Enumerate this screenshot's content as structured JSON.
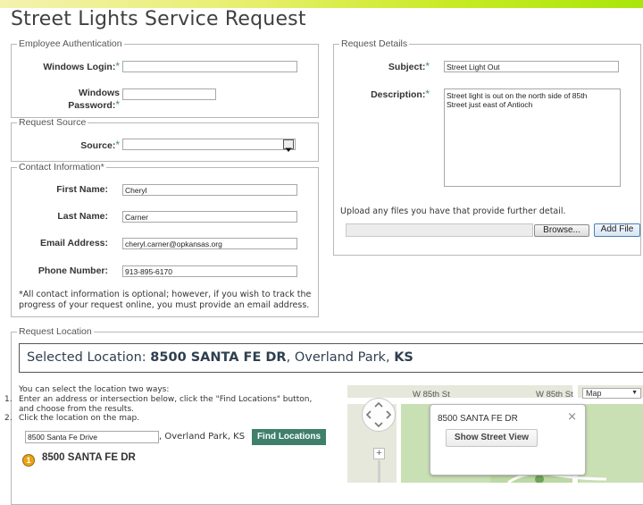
{
  "page": {
    "title": "Street Lights Service Request"
  },
  "auth": {
    "legend": "Employee Authentication",
    "login_label": "Windows Login:",
    "password_label_line1": "Windows",
    "password_label_line2": "Password:",
    "required_mark": "*",
    "login_value": "",
    "password_value": ""
  },
  "source": {
    "legend": "Request Source",
    "label": "Source:",
    "value": ""
  },
  "contact": {
    "legend": "Contact Information*",
    "first_name_label": "First Name:",
    "first_name_value": "Cheryl",
    "last_name_label": "Last Name:",
    "last_name_value": "Carner",
    "email_label": "Email Address:",
    "email_value": "cheryl.carner@opkansas.org",
    "phone_label": "Phone Number:",
    "phone_value": "913-895-6170",
    "note_line1": "*All contact information is optional; however, if you wish to track the",
    "note_line2": "progress of your request online, you must provide an email address."
  },
  "details": {
    "legend": "Request Details",
    "subject_label": "Subject:",
    "subject_value": "Street Light Out",
    "description_label": "Description:",
    "description_value": "Street light is out on the north side of 85th Street just east of Antioch",
    "upload_text": "Upload any files you have that provide further detail.",
    "browse_label": "Browse...",
    "add_file_label": "Add File"
  },
  "location": {
    "legend": "Request Location",
    "selected_prefix": "Selected Location: ",
    "selected_street": "8500 SANTA FE DR",
    "selected_city": ", Overland Park, ",
    "selected_state": "KS",
    "instructions": "You can select the location two ways:",
    "step1_num": "1.",
    "step1_line1": "Enter an address or intersection below, click the \"Find Locations\" button,",
    "step1_line2": "and choose from the results.",
    "step2_num": "2.",
    "step2_text": "Click the location on the map.",
    "address_value": "8500 Santa Fe Drive",
    "city_suffix": ", Overland Park, KS",
    "find_button": "Find Locations",
    "result_number": "1",
    "result_text": "8500 SANTA FE DR"
  },
  "map": {
    "street_label_1": "W 85th St",
    "street_label_2": "W 85th St",
    "map_type": "Map",
    "popup_address": "8500 SANTA FE DR",
    "popup_button": "Show Street View",
    "popup_close": "×",
    "zoom_in": "+"
  }
}
